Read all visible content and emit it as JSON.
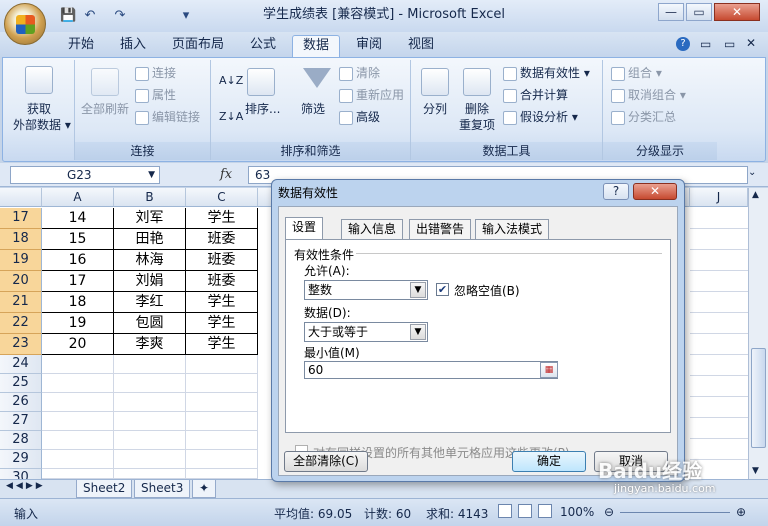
{
  "window": {
    "title": "学生成绩表  [兼容模式] - Microsoft Excel",
    "min": "—",
    "max": "▭",
    "close": "✕"
  },
  "qat": {
    "save": "💾",
    "undo": "↶",
    "redo": "↷",
    "more": "▾"
  },
  "tabs": [
    "开始",
    "插入",
    "页面布局",
    "公式",
    "数据",
    "审阅",
    "视图"
  ],
  "active_tab": "数据",
  "ribbon": {
    "get_external": "获取\n外部数据",
    "get_external_l1": "获取",
    "get_external_l2": "外部数据 ▾",
    "refresh_all": "全部刷新",
    "connections": "连接",
    "properties": "属性",
    "edit_links": "编辑链接",
    "group_connections": "连接",
    "sort_az": "A↓Z",
    "sort": "排序...",
    "filter": "筛选",
    "clear": "清除",
    "reapply": "重新应用",
    "advanced": "高级",
    "group_sort": "排序和筛选",
    "text_to_cols": "分列",
    "remove_dup_l1": "删除",
    "remove_dup_l2": "重复项",
    "data_validation": "数据有效性 ▾",
    "consolidate": "合并计算",
    "whatif": "假设分析 ▾",
    "group_tools": "数据工具",
    "group_btn": "组合 ▾",
    "ungroup": "取消组合 ▾",
    "subtotal": "分类汇总",
    "group_outline": "分级显示"
  },
  "formula": {
    "name_box": "G23",
    "fx": "fx",
    "value": "63"
  },
  "columns": [
    "A",
    "B",
    "C"
  ],
  "last_col": "J",
  "rows": [
    {
      "n": "17",
      "a": "14",
      "b": "刘军",
      "c": "学生"
    },
    {
      "n": "18",
      "a": "15",
      "b": "田艳",
      "c": "班委"
    },
    {
      "n": "19",
      "a": "16",
      "b": "林海",
      "c": "班委"
    },
    {
      "n": "20",
      "a": "17",
      "b": "刘娟",
      "c": "班委"
    },
    {
      "n": "21",
      "a": "18",
      "b": "李红",
      "c": "学生"
    },
    {
      "n": "22",
      "a": "19",
      "b": "包圆",
      "c": "学生"
    },
    {
      "n": "23",
      "a": "20",
      "b": "李爽",
      "c": "学生"
    }
  ],
  "empty_rows": [
    "24",
    "25",
    "26",
    "27",
    "28",
    "29",
    "30"
  ],
  "sheets": [
    "Sheet2",
    "Sheet3"
  ],
  "status": {
    "mode": "输入",
    "average": "平均值: 69.05",
    "count": "计数: 60",
    "sum": "求和: 4143",
    "zoom": "100%"
  },
  "dialog": {
    "title": "数据有效性",
    "help": "?",
    "close": "✕",
    "tabs": [
      "设置",
      "输入信息",
      "出错警告",
      "输入法模式"
    ],
    "criteria": "有效性条件",
    "allow_label": "允许(A):",
    "allow_value": "整数",
    "ignore_blank": "忽略空值(B)",
    "data_label": "数据(D):",
    "data_value": "大于或等于",
    "min_label": "最小值(M)",
    "min_value": "60",
    "apply_all": "对有同样设置的所有其他单元格应用这些更改(P)",
    "clear_all": "全部清除(C)",
    "ok": "确定",
    "cancel": "取消"
  },
  "watermark": {
    "text": "Baidu经验",
    "sub": "jingyan.baidu.com"
  }
}
